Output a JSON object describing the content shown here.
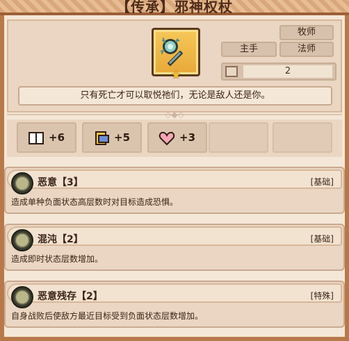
{
  "item": {
    "title": "【传承】邪神权杖",
    "tags": {
      "class_1": "牧师",
      "class_2": "法师",
      "slot": "主手"
    },
    "slot_count": "2",
    "description": "只有死亡才可以取悦祂们，无论是敌人还是你。"
  },
  "stats": [
    {
      "icon": "book-icon",
      "value": "+6"
    },
    {
      "icon": "scroll-icon",
      "value": "+5"
    },
    {
      "icon": "heart-icon",
      "value": "+3"
    }
  ],
  "skills": [
    {
      "name": "恶意【3】",
      "type": "[基础]",
      "description": "造成单种负面状态高层数时对目标造成恐惧。"
    },
    {
      "name": "混沌【2】",
      "type": "[基础]",
      "description": "造成即时状态层数增加。"
    },
    {
      "name": "恶意残存【2】",
      "type": "[特殊]",
      "description": "自身战败后使敌方最近目标受到负面状态层数增加。"
    }
  ],
  "colors": {
    "frame": "#b8794a",
    "panel": "#ead6c2",
    "gold": "#e8a838"
  }
}
